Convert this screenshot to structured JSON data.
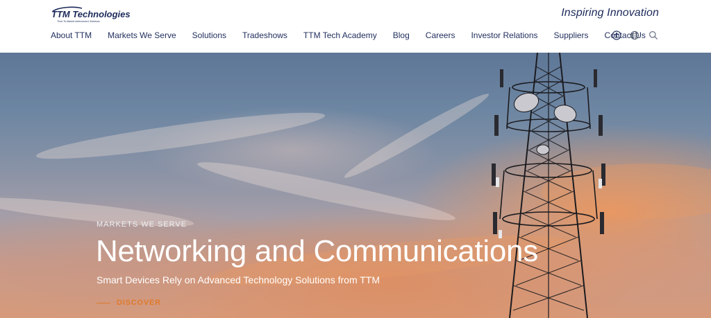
{
  "header": {
    "logo": {
      "brand": "TTM Technologies",
      "subtext": "Time-To-Market Interconnect Solutions"
    },
    "tagline": "Inspiring Innovation",
    "nav": [
      {
        "label": "About TTM"
      },
      {
        "label": "Markets We Serve"
      },
      {
        "label": "Solutions"
      },
      {
        "label": "Tradeshows"
      },
      {
        "label": "TTM Tech Academy"
      },
      {
        "label": "Blog"
      },
      {
        "label": "Careers"
      },
      {
        "label": "Investor Relations"
      },
      {
        "label": "Suppliers"
      },
      {
        "label": "Contact Us"
      }
    ],
    "icons": [
      "accessibility-icon",
      "globe-icon",
      "search-icon"
    ]
  },
  "hero": {
    "eyebrow": "MARKETS WE SERVE",
    "title": "Networking and Communications",
    "subtitle": "Smart Devices Rely on Advanced Technology Solutions from TTM",
    "cta_label": "DISCOVER"
  },
  "colors": {
    "nav_text": "#1f2d5c",
    "tagline": "#1c2a5a",
    "cta_accent": "#e07a2c",
    "hero_text": "#ffffff"
  }
}
